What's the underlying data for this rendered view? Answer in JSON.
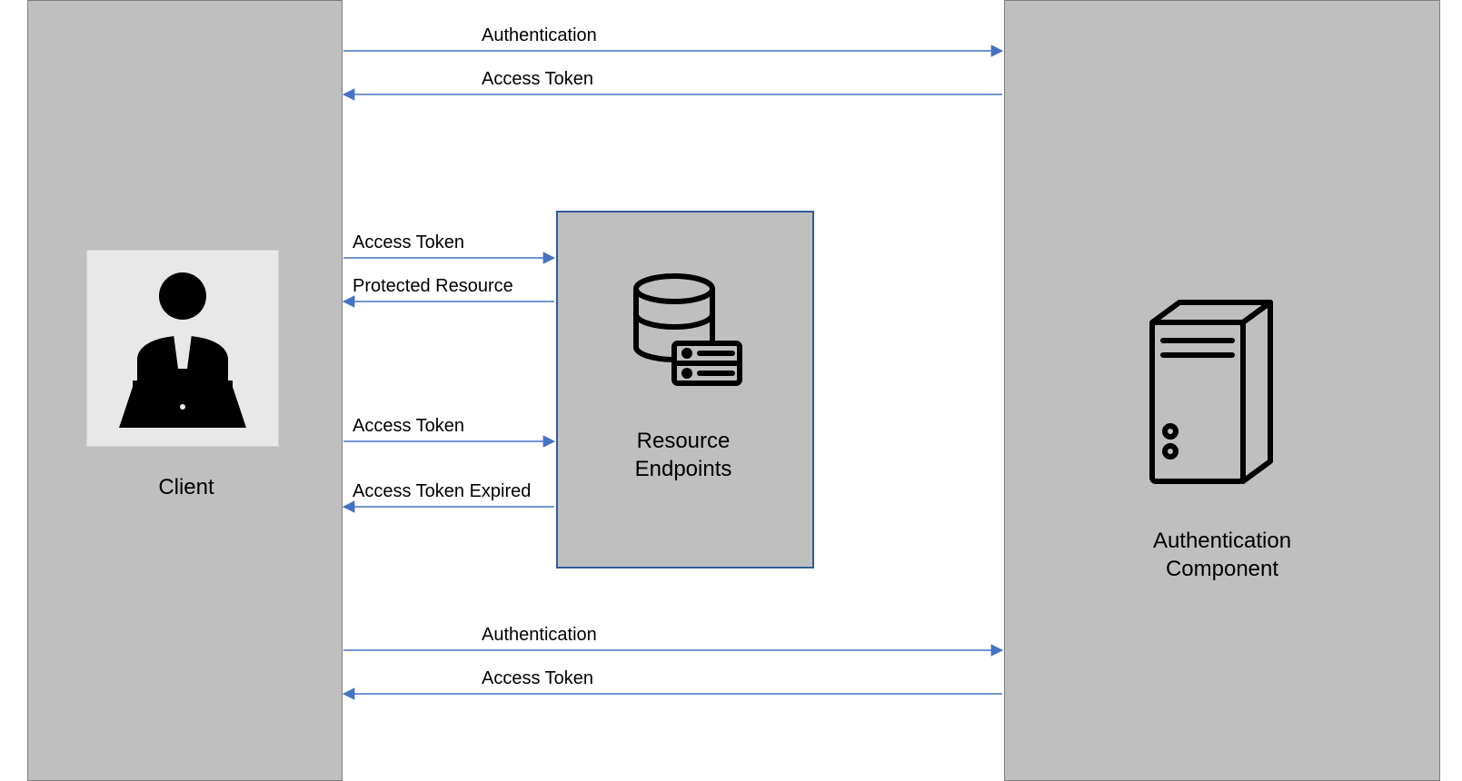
{
  "nodes": {
    "client_label": "Client",
    "resource_label_line1": "Resource",
    "resource_label_line2": "Endpoints",
    "auth_label_line1": "Authentication",
    "auth_label_line2": "Component"
  },
  "messages": {
    "m1": "Authentication",
    "m2": "Access Token",
    "m3": "Access Token",
    "m4": "Protected Resource",
    "m5": "Access Token",
    "m6": "Access Token Expired",
    "m7": "Authentication",
    "m8": "Access Token"
  },
  "colors": {
    "panel_fill": "#bfbfbf",
    "panel_border": "#7f7f7f",
    "resource_border": "#2E5C9A",
    "arrow": "#4472C4"
  }
}
